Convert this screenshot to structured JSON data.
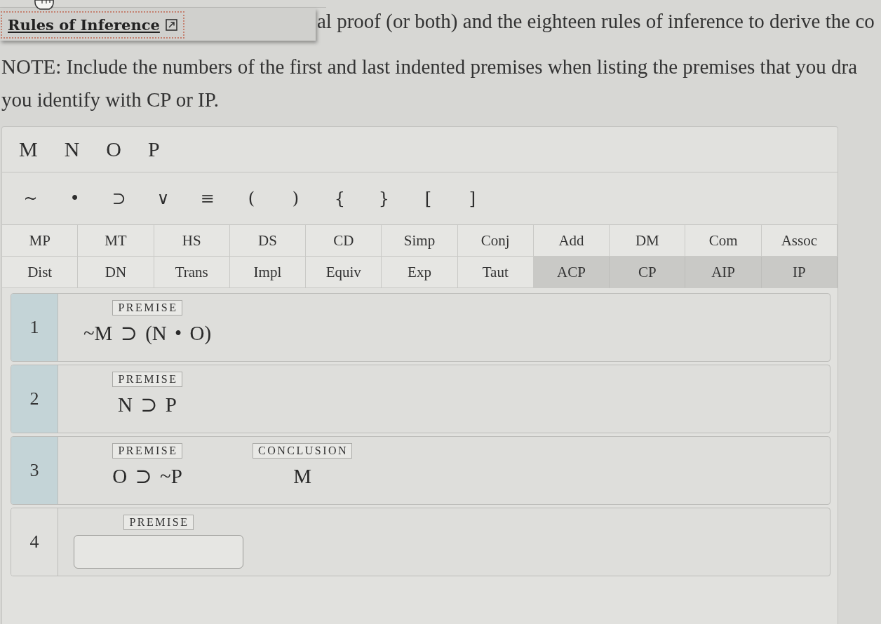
{
  "link_popup": {
    "link": "Rules of Inference",
    "focused": true
  },
  "intro_text": "al proof (or both) and the eighteen rules of inference to derive the co",
  "note_lines": [
    "NOTE: Include the numbers of the first and last indented premises when listing the premises that you dra",
    "you identify with CP or IP."
  ],
  "variables": [
    "M",
    "N",
    "O",
    "P"
  ],
  "operators": [
    "~",
    "•",
    "⊃",
    "∨",
    "≡",
    "(",
    ")",
    "{",
    "}",
    "[",
    "]"
  ],
  "rules": [
    {
      "label": "MP",
      "kind": "rule"
    },
    {
      "label": "MT",
      "kind": "rule"
    },
    {
      "label": "HS",
      "kind": "rule"
    },
    {
      "label": "DS",
      "kind": "rule"
    },
    {
      "label": "CD",
      "kind": "rule"
    },
    {
      "label": "Simp",
      "kind": "rule"
    },
    {
      "label": "Conj",
      "kind": "rule"
    },
    {
      "label": "Add",
      "kind": "rule"
    },
    {
      "label": "DM",
      "kind": "rule"
    },
    {
      "label": "Com",
      "kind": "rule"
    },
    {
      "label": "Assoc",
      "kind": "rule"
    },
    {
      "label": "Dist",
      "kind": "rule"
    },
    {
      "label": "DN",
      "kind": "rule"
    },
    {
      "label": "Trans",
      "kind": "rule"
    },
    {
      "label": "Impl",
      "kind": "rule"
    },
    {
      "label": "Equiv",
      "kind": "rule"
    },
    {
      "label": "Exp",
      "kind": "rule"
    },
    {
      "label": "Taut",
      "kind": "rule"
    },
    {
      "label": "ACP",
      "kind": "proof"
    },
    {
      "label": "CP",
      "kind": "proof"
    },
    {
      "label": "AIP",
      "kind": "proof"
    },
    {
      "label": "IP",
      "kind": "proof"
    }
  ],
  "lines": [
    {
      "number": "1",
      "kind": "given",
      "label": "PREMISE",
      "formula": "~M ⊃ (N • O)"
    },
    {
      "number": "2",
      "kind": "given",
      "label": "PREMISE",
      "formula": "N ⊃ P"
    },
    {
      "number": "3",
      "kind": "given",
      "label": "PREMISE",
      "formula": "O ⊃ ~P",
      "conclusion": {
        "label": "CONCLUSION",
        "formula": "M"
      }
    },
    {
      "number": "4",
      "kind": "blank",
      "label": "PREMISE"
    }
  ]
}
